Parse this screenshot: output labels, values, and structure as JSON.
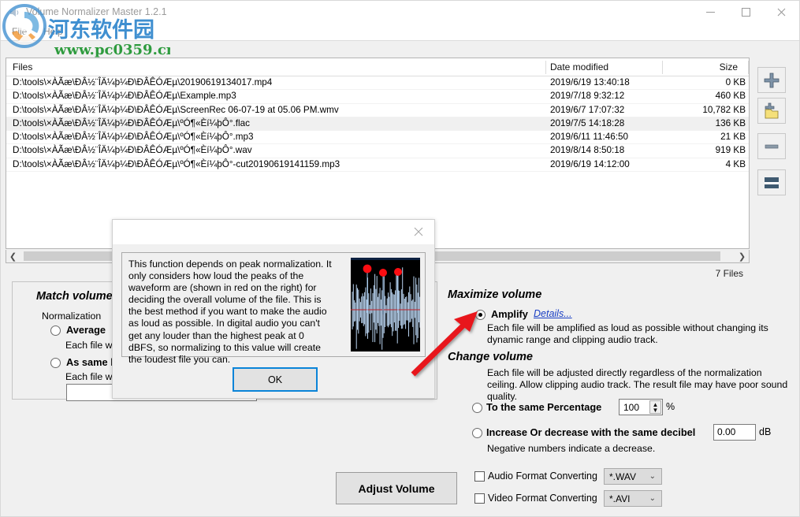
{
  "window": {
    "title": "Volume Normalizer Master 1.2.1",
    "app_icon": "app-icon",
    "minimize": "–",
    "maximize": "□",
    "close": "✕"
  },
  "menubar": {
    "items": [
      {
        "label": "File"
      },
      {
        "label": "Help"
      }
    ]
  },
  "file_list": {
    "columns": [
      "Files",
      "Date modified",
      "Size"
    ],
    "rows": [
      {
        "path": "D:\\tools\\×ÀÃæ\\ÐÂ½¨ÎÄ¼þ¼Ð\\ÐÂÊÓÆµ\\20190619134017.mp4",
        "date": "2019/6/19 13:40:18",
        "size": "0 KB",
        "selected": false
      },
      {
        "path": "D:\\tools\\×ÀÃæ\\ÐÂ½¨ÎÄ¼þ¼Ð\\ÐÂÊÓÆµ\\Example.mp3",
        "date": "2019/7/18 9:32:12",
        "size": "460 KB",
        "selected": false
      },
      {
        "path": "D:\\tools\\×ÀÃæ\\ÐÂ½¨ÎÄ¼þ¼Ð\\ÐÂÊÓÆµ\\ScreenRec 06-07-19 at 05.06 PM.wmv",
        "date": "2019/6/7 17:07:32",
        "size": "10,782 KB",
        "selected": false
      },
      {
        "path": "D:\\tools\\×ÀÃæ\\ÐÂ½¨ÎÄ¼þ¼Ð\\ÐÂÊÓÆµ\\ºÓ¶«Èí¼þÔ°.flac",
        "date": "2019/7/5 14:18:28",
        "size": "136 KB",
        "selected": true
      },
      {
        "path": "D:\\tools\\×ÀÃæ\\ÐÂ½¨ÎÄ¼þ¼Ð\\ÐÂÊÓÆµ\\ºÓ¶«Èí¼þÔ°.mp3",
        "date": "2019/6/11 11:46:50",
        "size": "21 KB",
        "selected": false
      },
      {
        "path": "D:\\tools\\×ÀÃæ\\ÐÂ½¨ÎÄ¼þ¼Ð\\ÐÂÊÓÆµ\\ºÓ¶«Èí¼þÔ°.wav",
        "date": "2019/8/14 8:50:18",
        "size": "919 KB",
        "selected": false
      },
      {
        "path": "D:\\tools\\×ÀÃæ\\ÐÂ½¨ÎÄ¼þ¼Ð\\ÐÂÊÓÆµ\\ºÓ¶«Èí¼þÔ°-cut20190619141159.mp3",
        "date": "2019/6/19 14:12:00",
        "size": "4 KB",
        "selected": false
      }
    ],
    "status": "7 Files",
    "scroll_left": "❮",
    "scroll_right": "❯"
  },
  "toolbar": {
    "add_file": "add-file-icon",
    "add_folder": "add-folder-icon",
    "remove": "remove-icon",
    "clear": "clear-list-icon"
  },
  "match_volume": {
    "title": "Match volume",
    "normalization_label": "Normalization",
    "average_label": "Average",
    "average_desc": "Each file w",
    "assame_label": "As same l",
    "assame_desc": "Each file w",
    "level_value": ""
  },
  "maximize_volume": {
    "title": "Maximize volume",
    "amplify_label": "Amplify",
    "details_link": "Details...",
    "amplify_desc": "Each file will be amplified as loud as possible without changing its dynamic range and clipping audio track."
  },
  "change_volume": {
    "title": "Change volume",
    "desc": "Each file will be adjusted directly regardless of the normalization ceiling. Allow clipping audio track. The result file may have poor sound quality.",
    "percentage_label": "To the same Percentage",
    "percentage_value": "100",
    "percentage_unit": "%",
    "decibel_label": "Increase Or decrease with the same decibel",
    "decibel_value": "0.00",
    "decibel_unit": "dB",
    "decibel_note": "Negative numbers indicate a decrease."
  },
  "bottom": {
    "adjust_button": "Adjust Volume",
    "audio_convert_label": "Audio Format Converting",
    "audio_format": "*.WAV",
    "video_convert_label": "Video Format Converting",
    "video_format": "*.AVI",
    "caret": "⌄"
  },
  "dialog": {
    "close": "✕",
    "text": "This function depends on peak normalization. It only considers how loud the peaks of the waveform are (shown in red on the right) for deciding the overall volume of the file. This is the best method if you want to make the audio as loud as possible. In digital audio you can't get any louder than the highest peak at 0 dBFS, so normalizing to this value will create the loudest file you can.",
    "ok_label": "OK",
    "waveform_alt": "peak-waveform-illustration"
  },
  "watermark": {
    "cn_text": "河东软件园",
    "url_text": "www.pc0359.cn",
    "cn_color": "#3f8fd0",
    "url_color": "#2e9b3e"
  },
  "colors": {
    "accent_blue": "#0a84d8",
    "link_blue": "#1a3fc4",
    "annotation_red": "#e8191b",
    "selection_gray": "#f0f0f0"
  }
}
